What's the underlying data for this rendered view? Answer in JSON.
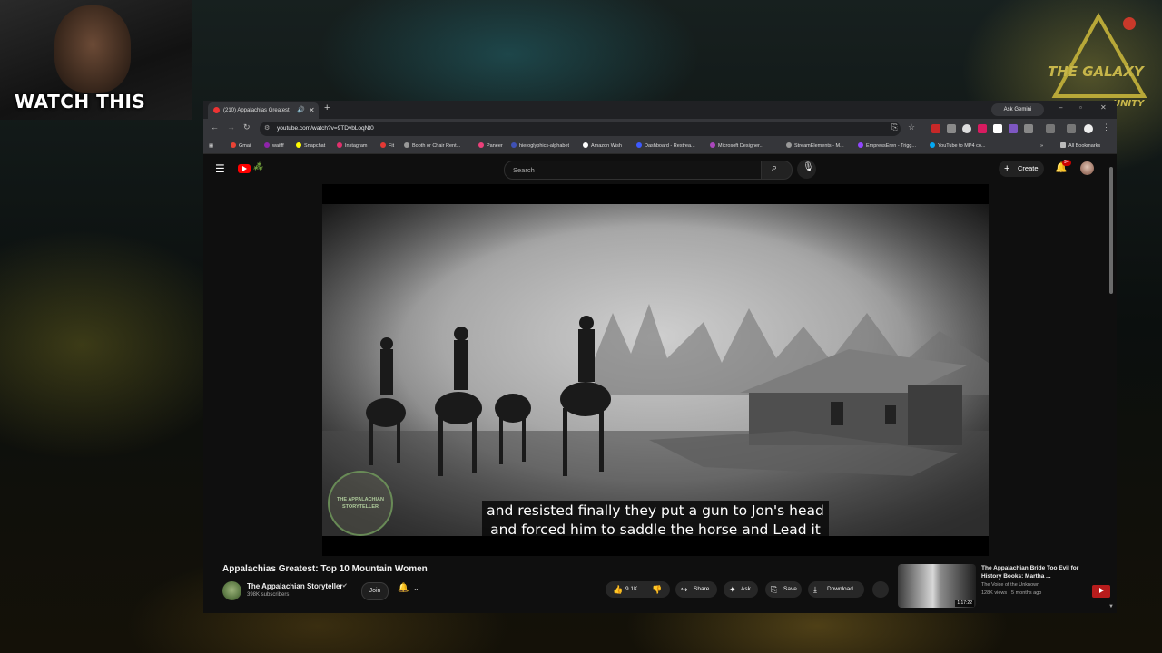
{
  "overlay": {
    "cam_label": "WATCH THIS",
    "logo_text": "THE GALAXY",
    "logo_text_2": "UNITY"
  },
  "browser": {
    "tab_title": "(210) Appalachias Greatest",
    "url": "youtube.com/watch?v=9TDvbLoqNt0",
    "ask_gemini": "Ask Gemini",
    "bookmarks": [
      "Gmail",
      "waifff",
      "Snapchat",
      "Instagram",
      "Fit",
      "Booth or Chair Rent...",
      "Paneer",
      "hieroglyphics-alphabet",
      "Amazon Wish",
      "Dashboard - Restrea...",
      "Microsoft Designer...",
      "StreamElements - M...",
      "EmpressEren - Trigg...",
      "YouTube to MP4 co..."
    ],
    "all_bookmarks": "All Bookmarks",
    "colors": {
      "titlebar": "#202124",
      "toolbar": "#35363a"
    }
  },
  "youtube": {
    "search_placeholder": "Search",
    "create_label": "Create",
    "notification_count": "9+",
    "video": {
      "caption_line1": "and resisted finally they put a gun to Jon's head",
      "caption_line2": "and forced him to saddle the horse and Lead it",
      "watermark_text_1": "THE APPALACHIAN",
      "watermark_text_2": "STORYTELLER"
    },
    "title": "Appalachias Greatest: Top 10 Mountain Women",
    "channel": {
      "name": "The Appalachian Storyteller",
      "subscribers": "398K subscribers",
      "join_label": "Join"
    },
    "actions": {
      "like_count": "9.1K",
      "share": "Share",
      "ask": "Ask",
      "save": "Save",
      "download": "Download"
    },
    "suggested": {
      "title": "The Appalachian Bride Too Evil for History Books: Martha ...",
      "channel": "The Voice of the Unknown",
      "meta": "128K views · 5 months ago",
      "duration": "1:17:22"
    },
    "colors": {
      "brand_red": "#ff0000",
      "background": "#0f0f0f"
    }
  }
}
